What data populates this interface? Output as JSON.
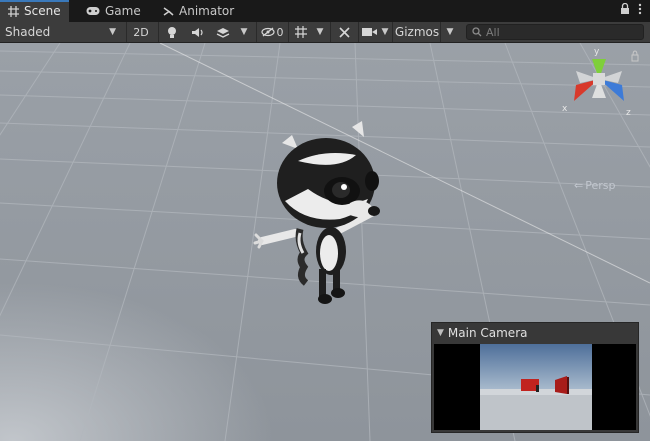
{
  "tabs": [
    {
      "label": "Scene",
      "icon": "grid-icon",
      "active": true
    },
    {
      "label": "Game",
      "icon": "gamepad-icon",
      "active": false
    },
    {
      "label": "Animator",
      "icon": "animator-icon",
      "active": false
    }
  ],
  "toolbar": {
    "draw_mode": "Shaded",
    "mode_2d": "2D",
    "hidden_count": "0",
    "gizmos": "Gizmos",
    "search_placeholder": "All"
  },
  "scene": {
    "gizmo": {
      "x": "x",
      "y": "y",
      "z": "z"
    },
    "projection": "Persp"
  },
  "camera_preview": {
    "title": "Main Camera"
  },
  "colors": {
    "accent": "#3a79bb",
    "axis_x": "#d8392b",
    "axis_y": "#7fcf3a",
    "axis_z": "#3d7bd8",
    "toolbar_bg": "#3c3c3c"
  }
}
